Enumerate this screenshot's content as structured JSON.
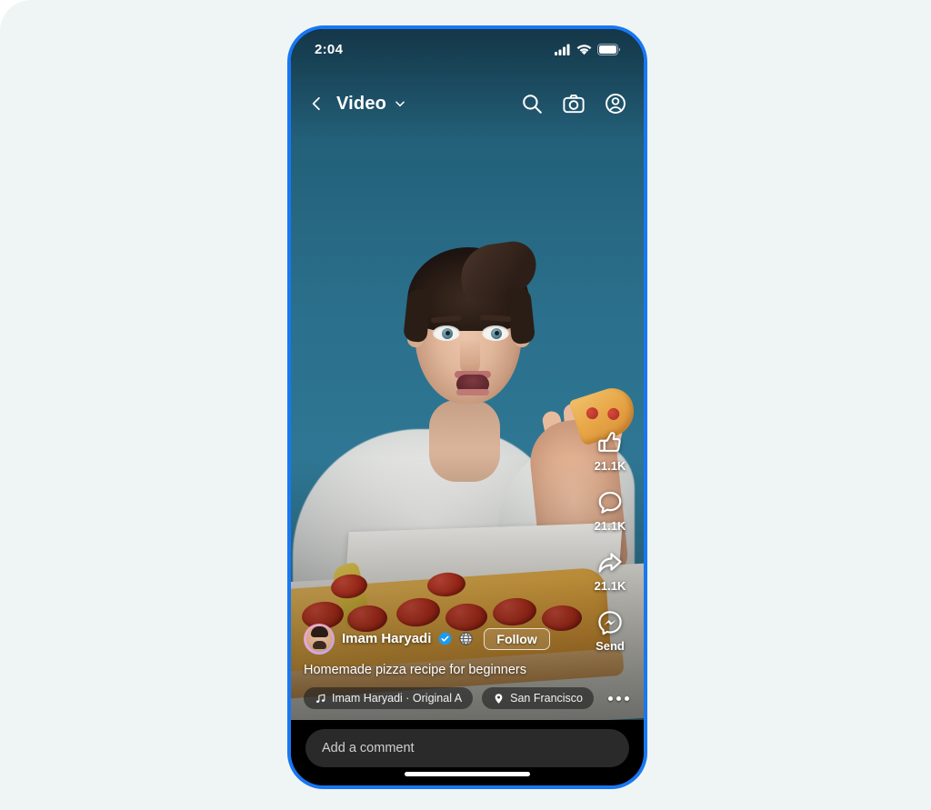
{
  "page": {
    "background_color": "#eff5f5",
    "frame_accent_color": "#1877f2"
  },
  "status_bar": {
    "time": "2:04",
    "signal_icon": "cellular-signal-icon",
    "wifi_icon": "wifi-icon",
    "battery_icon": "battery-full-icon"
  },
  "header": {
    "back_icon": "back-chevron-icon",
    "title": "Video",
    "caret_icon": "chevron-down-icon",
    "search_icon": "search-icon",
    "camera_icon": "camera-icon",
    "profile_icon": "profile-icon"
  },
  "actions": [
    {
      "id": "like",
      "icon": "thumbs-up-icon",
      "count": "21.1K"
    },
    {
      "id": "comment",
      "icon": "comment-bubble-icon",
      "count": "21.1K"
    },
    {
      "id": "share",
      "icon": "share-arrow-icon",
      "count": "21.1K"
    },
    {
      "id": "send",
      "icon": "messenger-icon",
      "count": "Send"
    }
  ],
  "post": {
    "author_name": "Imam Haryadi",
    "verified_icon": "verified-badge-icon",
    "privacy_icon": "globe-public-icon",
    "follow_label": "Follow",
    "avatar_icon": "avatar",
    "caption": "Homemade pizza recipe for beginners",
    "music_icon": "music-note-icon",
    "music_label": "Imam Haryadi · Original A",
    "location_icon": "location-pin-icon",
    "location_label": "San Francisco",
    "more_icon": "more-options-icon"
  },
  "comment_bar": {
    "placeholder": "Add a comment"
  }
}
